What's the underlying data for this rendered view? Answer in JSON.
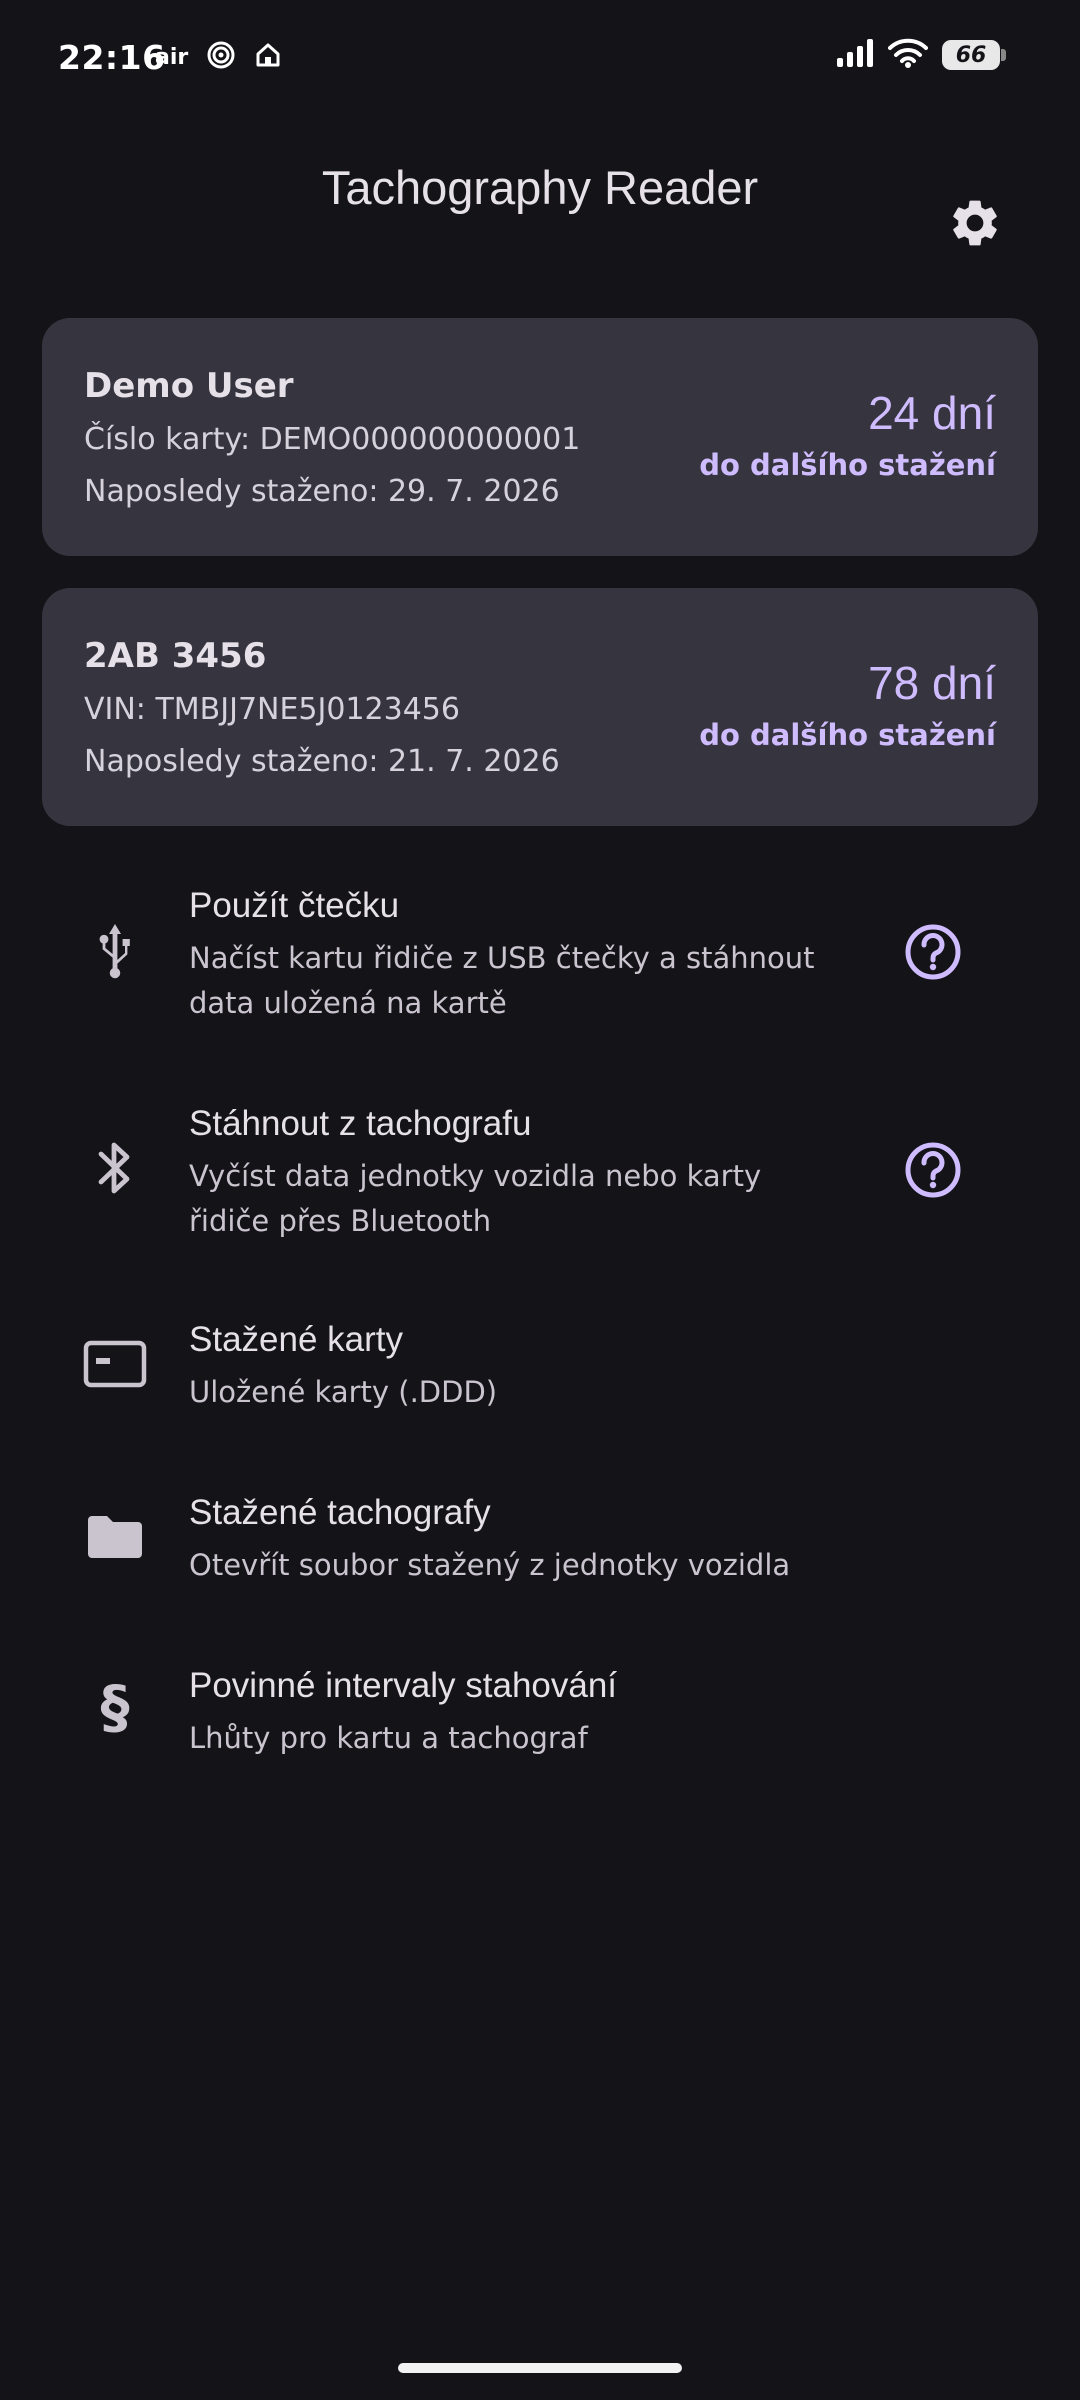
{
  "status_bar": {
    "time": "22:16",
    "air_label": "air",
    "battery": "66"
  },
  "header": {
    "title": "Tachography Reader",
    "settings_icon": "gear-icon"
  },
  "cards": [
    {
      "title": "Demo User",
      "line1": "Číslo karty: DEMO000000000001",
      "line2": "Naposledy staženo: 29. 7. 2026",
      "days": "24 dní",
      "days_label": "do dalšího stažení"
    },
    {
      "title": "2AB 3456",
      "line1": "VIN: TMBJJ7NE5J0123456",
      "line2": "Naposledy staženo: 21. 7. 2026",
      "days": "78 dní",
      "days_label": "do dalšího stažení"
    }
  ],
  "menu": {
    "reader": {
      "title": "Použít čtečku",
      "subtitle": "Načíst kartu řidiče z USB čtečky a stáhnout data uložená na kartě",
      "icon": "usb-icon"
    },
    "tachograph": {
      "title": "Stáhnout z tachografu",
      "subtitle": "Vyčíst data jednotky vozidla nebo karty řidiče přes Bluetooth",
      "icon": "bluetooth-icon"
    },
    "cards": {
      "title": "Stažené karty",
      "subtitle": "Uložené karty (.DDD)",
      "icon": "card-icon"
    },
    "tachographs": {
      "title": "Stažené tachografy",
      "subtitle": "Otevřít soubor stažený z jednotky vozidla",
      "icon": "folder-icon"
    },
    "intervals": {
      "title": "Povinné intervaly stahování",
      "subtitle": "Lhůty pro kartu a tachograf",
      "icon_glyph": "§"
    }
  },
  "colors": {
    "background": "#131318",
    "card": "#36343e",
    "accent": "#cfbcff"
  }
}
